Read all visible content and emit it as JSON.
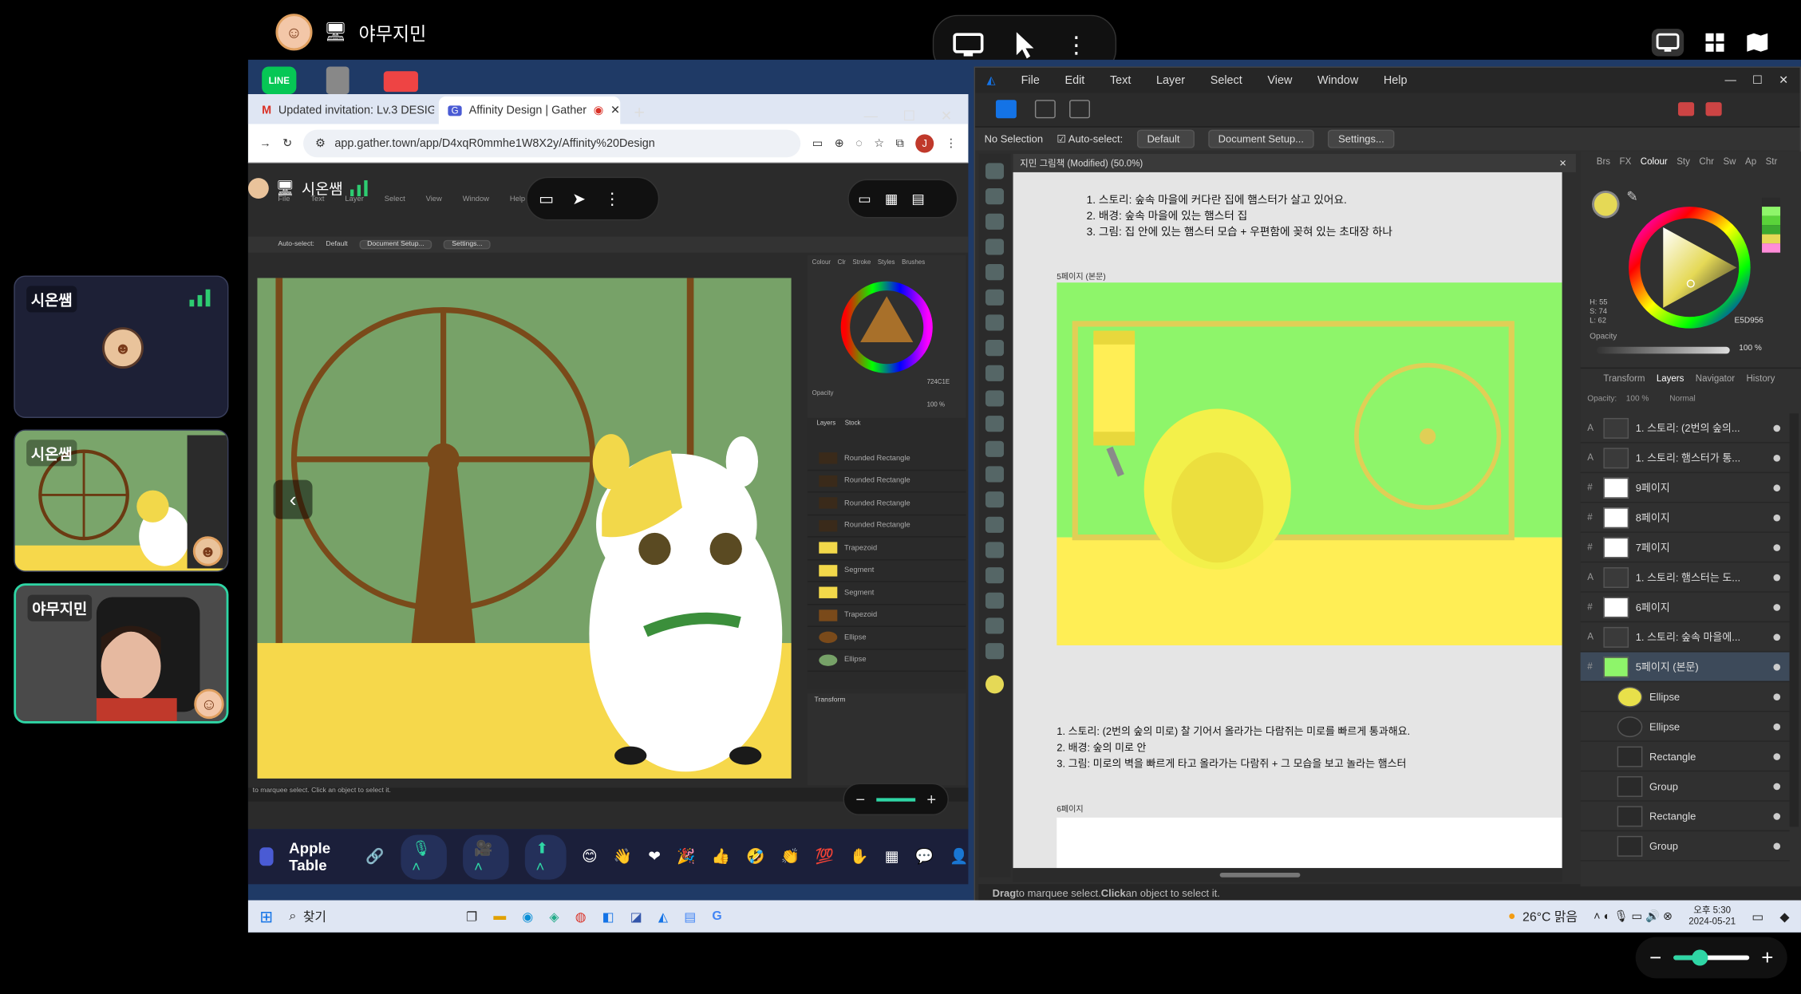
{
  "top_user": {
    "name": "야무지민"
  },
  "left_tiles": [
    {
      "name": "시온쌤"
    },
    {
      "name": "시온쌤"
    },
    {
      "name": "야무지민"
    }
  ],
  "chrome": {
    "tab1": "Updated invitation: Lv.3 DESIG",
    "tab2": "Affinity Design | Gather",
    "url": "app.gather.town/app/D4xqR0mmhe1W8X2y/Affinity%20Design",
    "profile": "J"
  },
  "inner": {
    "presenter": "시온쌤",
    "ctx_auto_select": "Auto-select:",
    "ctx_default": "Default",
    "ctx_doc_setup": "Document Setup...",
    "ctx_settings": "Settings...",
    "status": "to marquee select. Click an object to select it.",
    "layers_tabs": [
      "Layers",
      "Stock"
    ],
    "layers": [
      "Rounded Rectangle",
      "Rounded Rectangle",
      "Rounded Rectangle",
      "Rounded Rectangle",
      "Trapezoid",
      "Segment",
      "Segment",
      "Trapezoid",
      "Ellipse",
      "Ellipse"
    ],
    "panel_tabs": [
      "Colour",
      "Clr",
      "Stroke",
      "Styles",
      "Brushes"
    ],
    "transform": "Transform",
    "hex": "724C1E",
    "opacity": "Opacity",
    "opacity_val": "100 %",
    "menu": [
      "File",
      "Text",
      "Layer",
      "Select",
      "View",
      "Window",
      "Help"
    ]
  },
  "gather_bar": {
    "room": "Apple Table"
  },
  "affinity": {
    "menu": [
      "File",
      "Edit",
      "Text",
      "Layer",
      "Select",
      "View",
      "Window",
      "Help"
    ],
    "ctx_no_selection": "No Selection",
    "ctx_auto_select": "Auto-select:",
    "ctx_default": "Default",
    "ctx_doc_setup": "Document Setup...",
    "ctx_settings": "Settings...",
    "doc_title": "지민 그림책 (Modified) (50.0%)",
    "text_block1": [
      "1. 스토리: 숲속 마을에 커다란 집에 햄스터가 살고 있어요.",
      "2. 배경: 숲속 마을에 있는 햄스터 집",
      "3. 그림: 집 안에 있는 햄스터 모습 + 우편함에 꽂혀 있는 초대장 하나"
    ],
    "page5_label": "5페이지 (본문)",
    "text_block2": [
      "1. 스토리: (2번의 숲의 미로) 찰 기어서 올라가는 다람쥐는 미로를 빠르게 통과해요.",
      "2. 배경: 숲의 미로 안",
      "3. 그림: 미로의 벽을 빠르게 타고 올라가는 다람쥐 + 그 모습을 보고 놀라는 햄스터"
    ],
    "page6_label": "6페이지",
    "status_bold1": "Drag",
    "status_mid": " to marquee select. ",
    "status_bold2": "Click",
    "status_end": " an object to select it.",
    "color_tabs": [
      "Brs",
      "FX",
      "Colour",
      "Sty",
      "Chr",
      "Sw",
      "Ap",
      "Str"
    ],
    "hsl": [
      "H: 55",
      "S: 74",
      "L: 62"
    ],
    "hex": "E5D956",
    "opacity": "Opacity",
    "opacity_val": "100 %",
    "layer_tabs": [
      "Transform",
      "Layers",
      "Navigator",
      "History"
    ],
    "layer_opacity": "Opacity:",
    "layer_opacity_val": "100 %",
    "blend": "Normal",
    "layers": [
      {
        "label": "1. 스토리: (2번의 숲의...",
        "mark": "A",
        "thumb": "#3a3a3a"
      },
      {
        "label": "1. 스토리: 햄스터가 통...",
        "mark": "A",
        "thumb": "#3a3a3a"
      },
      {
        "label": "9페이지",
        "mark": "#",
        "thumb": "#ffffff"
      },
      {
        "label": "8페이지",
        "mark": "#",
        "thumb": "#ffffff"
      },
      {
        "label": "7페이지",
        "mark": "#",
        "thumb": "#ffffff"
      },
      {
        "label": "1. 스토리: 햄스터는 도...",
        "mark": "A",
        "thumb": "#3a3a3a"
      },
      {
        "label": "6페이지",
        "mark": "#",
        "thumb": "#ffffff"
      },
      {
        "label": "1. 스토리: 숲속 마을에...",
        "mark": "A",
        "thumb": "#3a3a3a"
      },
      {
        "label": "5페이지 (본문)",
        "mark": "#",
        "thumb": "#8ef56a"
      },
      {
        "label": "Ellipse",
        "mark": "",
        "thumb": "#e8e04a"
      },
      {
        "label": "Ellipse",
        "mark": "",
        "thumb": "#2a2a2a"
      },
      {
        "label": "Rectangle",
        "mark": "",
        "thumb": "#2a2a2a"
      },
      {
        "label": "Group",
        "mark": "",
        "thumb": "#2a2a2a"
      },
      {
        "label": "Rectangle",
        "mark": "",
        "thumb": "#2a2a2a"
      },
      {
        "label": "Group",
        "mark": "",
        "thumb": "#2a2a2a"
      }
    ]
  },
  "taskbar": {
    "search": "찾기",
    "weather": "26°C 맑음",
    "time": "오후 5:30",
    "date": "2024-05-21"
  },
  "colors": {
    "canvas_green": "#8ef56a",
    "canvas_yellow": "#ffee55",
    "accent": "#1473e6"
  }
}
